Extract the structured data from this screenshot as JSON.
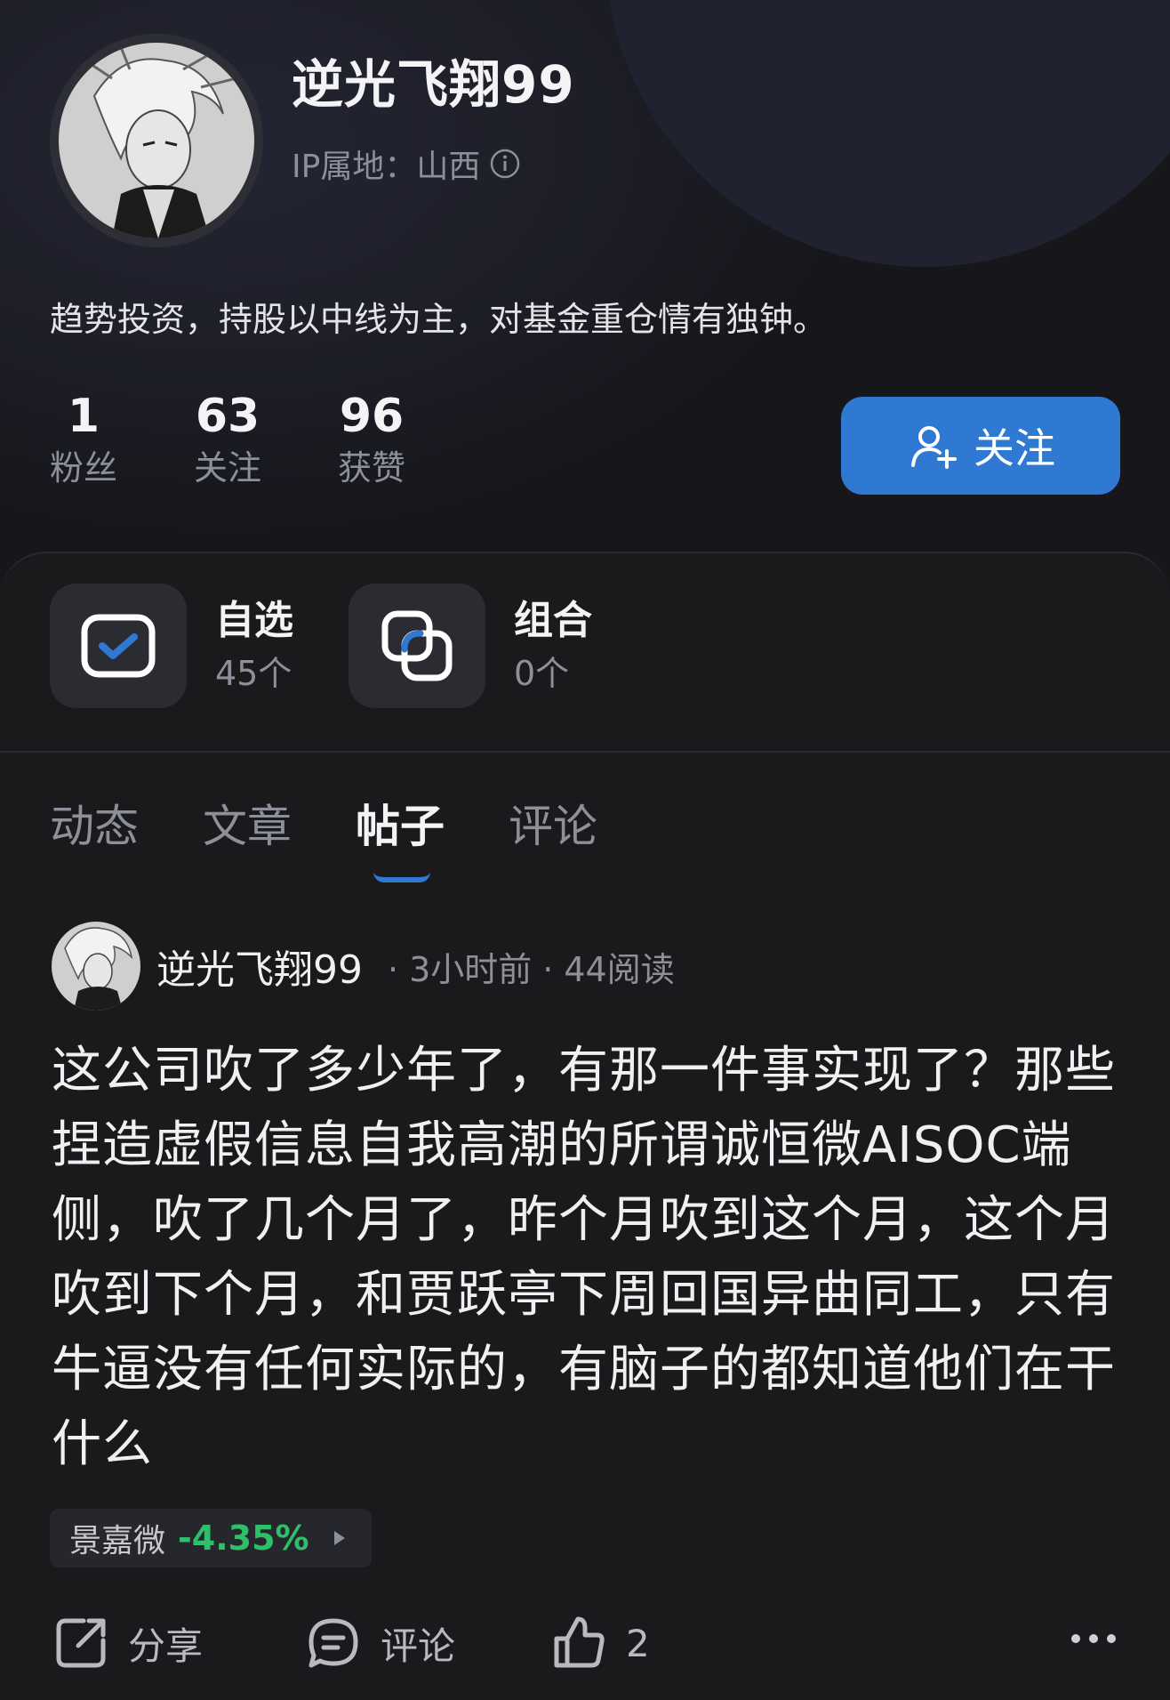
{
  "profile": {
    "username": "逆光飞翔99",
    "ip_location": "IP属地：山西",
    "bio": "趋势投资，持股以中线为主，对基金重仓情有独钟。",
    "follow_label": "关注",
    "stats": [
      {
        "value": "1",
        "label": "粉丝"
      },
      {
        "value": "63",
        "label": "关注"
      },
      {
        "value": "96",
        "label": "获赞"
      }
    ]
  },
  "quick_links": [
    {
      "title": "自选",
      "count": "45个",
      "icon": "checkbox-icon"
    },
    {
      "title": "组合",
      "count": "0个",
      "icon": "overlap-squares-icon"
    }
  ],
  "tabs": {
    "items": [
      "动态",
      "文章",
      "帖子",
      "评论"
    ],
    "active": "帖子"
  },
  "post": {
    "author": "逆光飞翔99",
    "time": "3小时前",
    "reads": "44阅读",
    "body": "这公司吹了多少年了，有那一件事实现了？那些捏造虚假信息自我高潮的所谓诚恒微AISOC端侧，吹了几个月了，昨个月吹到这个月，这个月吹到下个月，和贾跃亭下周回国异曲同工，只有牛逼没有任何实际的，有脑子的都知道他们在干什么",
    "stock": {
      "name": "景嘉微",
      "change": "-4.35%",
      "change_color": "#2fbf6a"
    },
    "actions": {
      "share": "分享",
      "comment": "评论",
      "like_count": "2"
    }
  },
  "colors": {
    "accent": "#2f79d3",
    "background": "#17171a",
    "down": "#2fbf6a"
  }
}
